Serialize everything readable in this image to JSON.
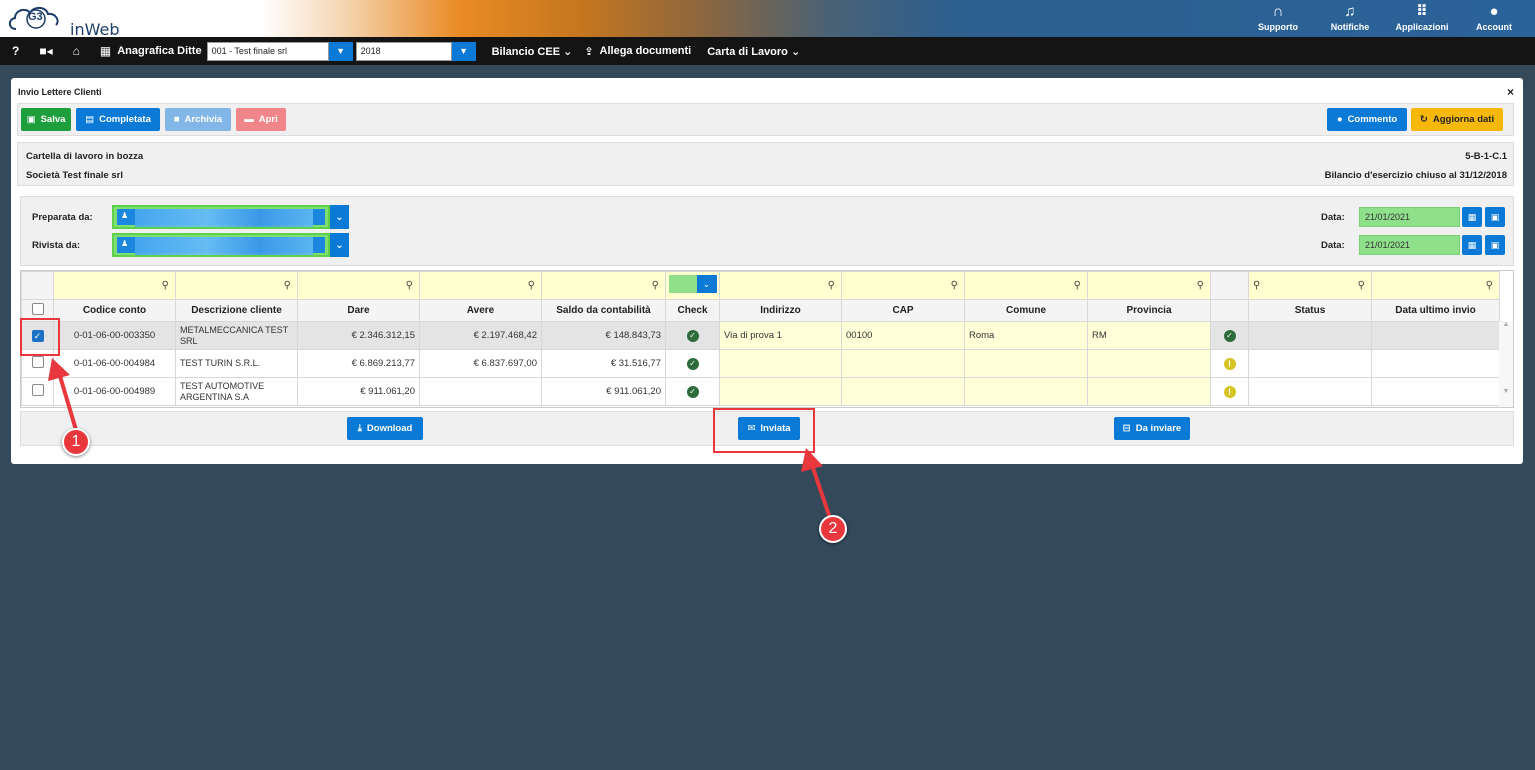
{
  "brand": {
    "logo_text": "inWeb",
    "logo_mark": "G3"
  },
  "top_actions": [
    {
      "label": "Supporto",
      "icon": "headset-icon",
      "glyph": "∩"
    },
    {
      "label": "Notifiche",
      "icon": "bell-icon",
      "glyph": "♫"
    },
    {
      "label": "Applicazioni",
      "icon": "grid-icon",
      "glyph": "⠿"
    },
    {
      "label": "Account",
      "icon": "user-circle-icon",
      "glyph": "●"
    }
  ],
  "nav": {
    "help": "?",
    "anagrafica_label": "Anagrafica Ditte",
    "company_value": "001 - Test finale srl",
    "year_value": "2018",
    "menu_bilancio": "Bilancio CEE ⌄",
    "menu_allega": "Allega documenti",
    "menu_carta": "Carta di Lavoro ⌄"
  },
  "panel": {
    "title": "Invio Lettere Clienti",
    "close": "×",
    "buttons": {
      "salva": "Salva",
      "completata": "Completata",
      "archivia": "Archivia",
      "apri": "Apri",
      "commento": "Commento",
      "aggiorna": "Aggiorna dati"
    },
    "info": {
      "status": "Cartella di lavoro in bozza",
      "code": "5-B-1-C.1",
      "company": "Società Test finale srl",
      "period": "Bilancio d'esercizio chiuso al 31/12/2018"
    },
    "people": {
      "prepared_label": "Preparata da:",
      "reviewed_label": "Rivista da:",
      "date_label": "Data:",
      "prepared_date": "21/01/2021",
      "reviewed_date": "21/01/2021"
    }
  },
  "table": {
    "columns": [
      "Codice conto",
      "Descrizione cliente",
      "Dare",
      "Avere",
      "Saldo da contabilità",
      "Check",
      "Indirizzo",
      "CAP",
      "Comune",
      "Provincia",
      "",
      "Status",
      "Data ultimo invio"
    ],
    "rows": [
      {
        "checked": true,
        "code": "0-01-06-00-003350",
        "desc": "METALMECCANICA TEST SRL",
        "dare": "€ 2.346.312,15",
        "avere": "€ 2.197.468,42",
        "saldo": "€ 148.843,73",
        "check": "ok",
        "indirizzo": "Via di prova 1",
        "cap": "00100",
        "comune": "Roma",
        "provincia": "RM",
        "addr_status": "ok",
        "status": "",
        "data_invio": ""
      },
      {
        "checked": false,
        "code": "0-01-06-00-004984",
        "desc": "TEST TURIN S.R.L.",
        "dare": "€ 6.869.213,77",
        "avere": "€ 6.837.697,00",
        "saldo": "€ 31.516,77",
        "check": "ok",
        "indirizzo": "",
        "cap": "",
        "comune": "",
        "provincia": "",
        "addr_status": "warn",
        "status": "",
        "data_invio": ""
      },
      {
        "checked": false,
        "code": "0-01-06-00-004989",
        "desc": "TEST AUTOMOTIVE ARGENTINA S.A",
        "dare": "€ 911.061,20",
        "avere": "",
        "saldo": "€ 911.061,20",
        "check": "ok",
        "indirizzo": "",
        "cap": "",
        "comune": "",
        "provincia": "",
        "addr_status": "warn",
        "status": "",
        "data_invio": ""
      }
    ]
  },
  "footer": {
    "download": "Download",
    "inviata": "Inviata",
    "da_inviare": "Da inviare"
  },
  "annotations": {
    "one": "1",
    "two": "2"
  },
  "colors": {
    "accent_blue": "#0a7ad6",
    "save_green": "#1e9e3c",
    "annotation_red": "#e8383d",
    "background": "#34495a"
  }
}
